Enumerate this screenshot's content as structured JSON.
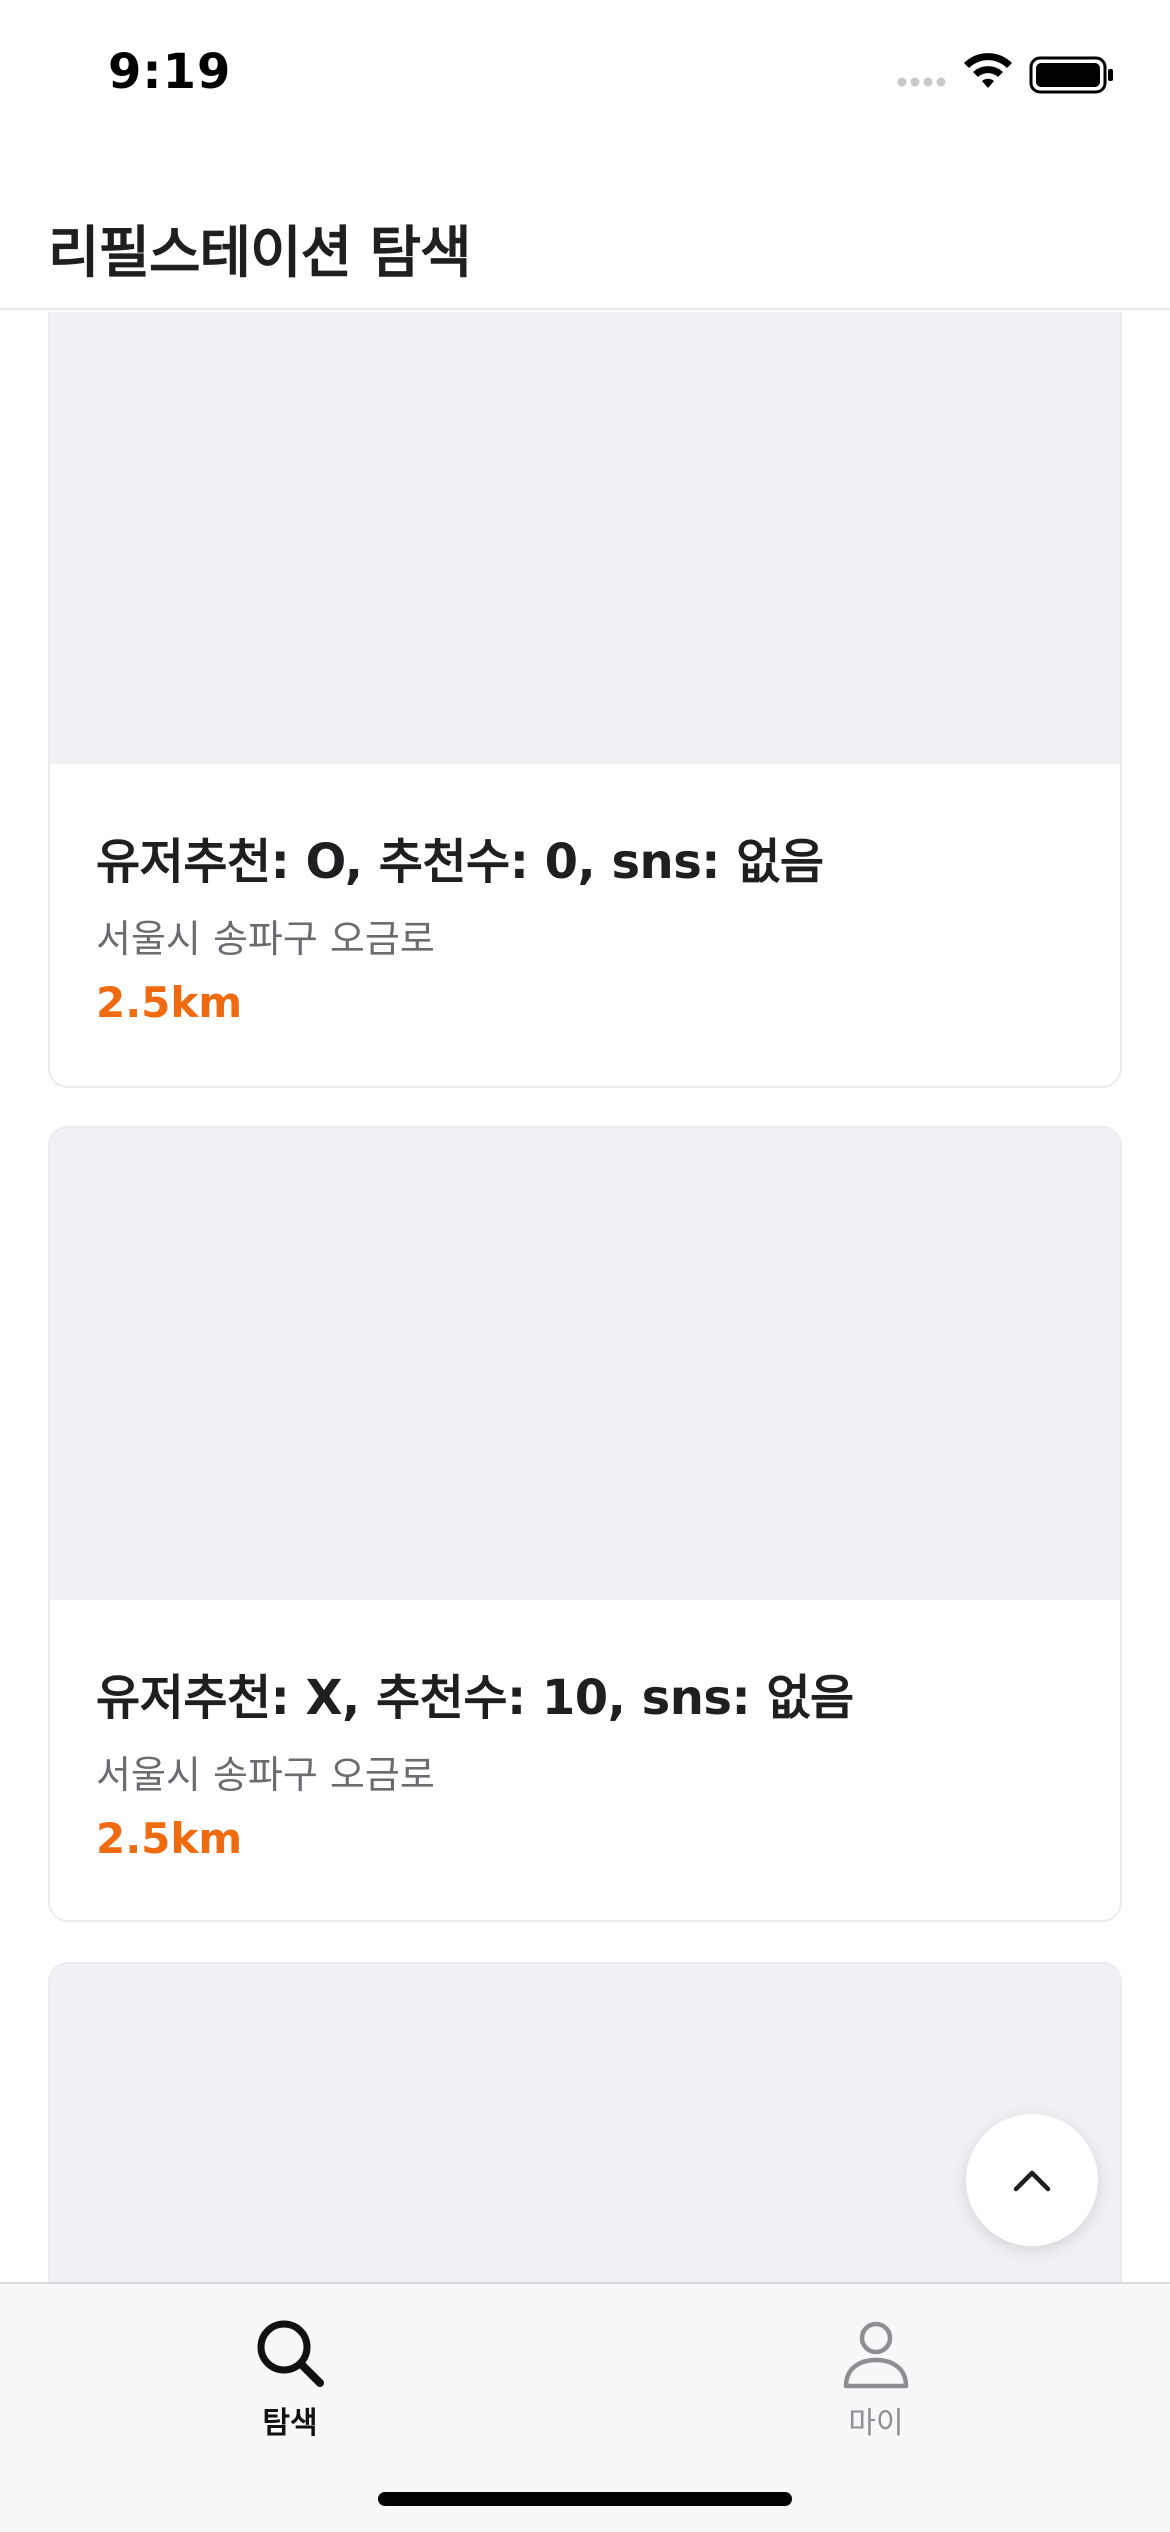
{
  "status_bar": {
    "time": "9:19"
  },
  "header": {
    "title": "리필스테이션 탐색"
  },
  "stations": [
    {
      "title": "유저추천: O, 추천수: 0, sns: 없음",
      "address": "서울시 송파구 오금로",
      "distance": "2.5km"
    },
    {
      "title": "유저추천: X, 추천수: 10, sns: 없음",
      "address": "서울시 송파구 오금로",
      "distance": "2.5km"
    }
  ],
  "tab_bar": {
    "tabs": [
      {
        "label": "탐색",
        "icon": "search-icon",
        "active": true
      },
      {
        "label": "마이",
        "icon": "person-icon",
        "active": false
      }
    ]
  },
  "colors": {
    "accent": "#f06a0f",
    "image_placeholder": "#f1f1f5",
    "text_primary": "#1f1f21",
    "text_secondary": "#6b6b70",
    "tab_inactive": "#8e8e93"
  }
}
